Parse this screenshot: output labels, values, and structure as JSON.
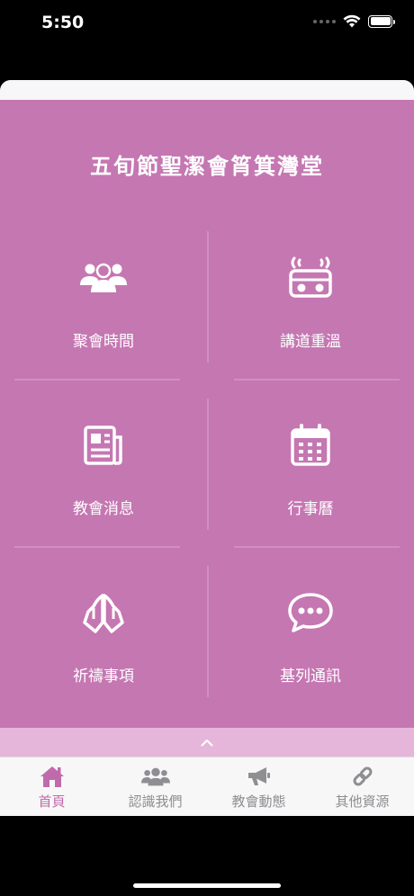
{
  "status": {
    "time": "5:50"
  },
  "app": {
    "title": "五旬節聖潔會筲箕灣堂"
  },
  "tiles": [
    {
      "label": "聚會時間",
      "icon": "people-group-icon"
    },
    {
      "label": "講道重溫",
      "icon": "radio-icon"
    },
    {
      "label": "教會消息",
      "icon": "newspaper-icon"
    },
    {
      "label": "行事曆",
      "icon": "calendar-icon"
    },
    {
      "label": "祈禱事項",
      "icon": "praying-hands-icon"
    },
    {
      "label": "基列通訊",
      "icon": "chat-bubble-icon"
    }
  ],
  "tabs": [
    {
      "label": "首頁",
      "icon": "home-icon",
      "active": true
    },
    {
      "label": "認識我們",
      "icon": "users-icon",
      "active": false
    },
    {
      "label": "教會動態",
      "icon": "megaphone-icon",
      "active": false
    },
    {
      "label": "其他資源",
      "icon": "link-icon",
      "active": false
    }
  ],
  "colors": {
    "primary": "#c577b2",
    "expand_bar": "#e6b6da",
    "tab_active": "#c06aac",
    "tab_inactive": "#8e8e93"
  }
}
